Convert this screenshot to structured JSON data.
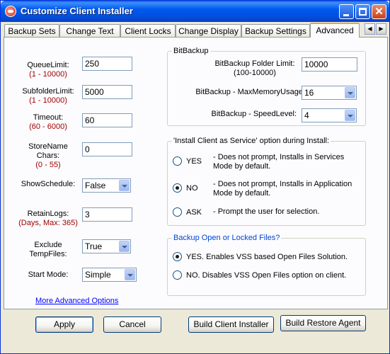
{
  "window": {
    "title": "Customize Client Installer"
  },
  "tabs": [
    {
      "label": "Backup Sets"
    },
    {
      "label": "Change Text"
    },
    {
      "label": "Client Locks"
    },
    {
      "label": "Change Display"
    },
    {
      "label": "Backup Settings"
    },
    {
      "label": "Advanced"
    }
  ],
  "left": {
    "queue": {
      "label": "QueueLimit:",
      "range": "(1 - 10000)",
      "value": "250"
    },
    "subfolder": {
      "label": "SubfolderLimit:",
      "range": "(1 - 10000)",
      "value": "5000"
    },
    "timeout": {
      "label": "Timeout:",
      "range": "(60 - 6000)",
      "value": "60"
    },
    "storename": {
      "label1": "StoreName",
      "label2": "Chars:",
      "range": "(0 - 55)",
      "value": "0"
    },
    "showschedule": {
      "label": "ShowSchedule:",
      "value": "False"
    },
    "retainlogs": {
      "label": "RetainLogs:",
      "range": "(Days, Max: 365)",
      "value": "3"
    },
    "exclude": {
      "label1": "Exclude",
      "label2": "TempFiles:",
      "value": "True"
    },
    "startmode": {
      "label": "Start Mode:",
      "value": "Simple"
    },
    "more_link": "More Advanced Options"
  },
  "bitbackup": {
    "title": "BitBackup",
    "folder_limit": {
      "label1": "BitBackup Folder Limit:",
      "label2": "(100-10000)",
      "value": "10000"
    },
    "max_memory": {
      "label": "BitBackup - MaxMemoryUsage:",
      "value": "16"
    },
    "speed": {
      "label": "BitBackup - SpeedLevel:",
      "value": "4"
    }
  },
  "service": {
    "title": "'Install Client as Service' option during Install:",
    "options": [
      {
        "label": "YES",
        "desc1": "- Does not prompt, Installs in Services",
        "desc2": "Mode by default.",
        "selected": false
      },
      {
        "label": "NO",
        "desc1": "- Does not prompt, Installs in Application",
        "desc2": "Mode by default.",
        "selected": true
      },
      {
        "label": "ASK",
        "desc1": "- Prompt the user for selection.",
        "desc2": "",
        "selected": false
      }
    ]
  },
  "openfiles": {
    "title": "Backup Open or Locked Files?",
    "options": [
      {
        "label": "YES. Enables VSS based Open Files Solution.",
        "selected": true
      },
      {
        "label": "NO. Disables VSS Open Files option on client.",
        "selected": false
      }
    ]
  },
  "buttons": {
    "apply": "Apply",
    "cancel": "Cancel",
    "build_client": "Build Client Installer",
    "build_restore": "Build Restore Agent"
  }
}
